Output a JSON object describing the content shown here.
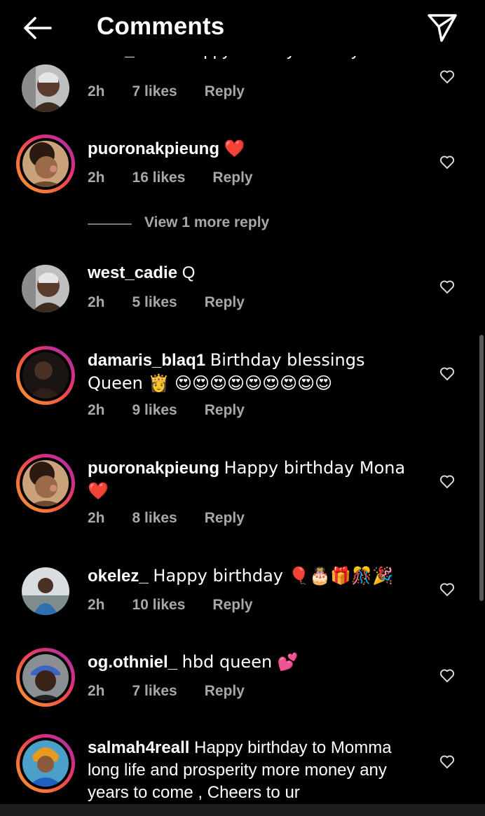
{
  "header": {
    "title": "Comments"
  },
  "comments": [
    {
      "username": "west_cadie",
      "text": "Happy birthday Mummy",
      "time": "2h",
      "likes": "7 likes",
      "reply": "Reply"
    },
    {
      "username": "puoronakpieung",
      "text": "❤️",
      "time": "2h",
      "likes": "16 likes",
      "reply": "Reply"
    },
    {
      "username": "west_cadie",
      "text": "Q",
      "time": "2h",
      "likes": "5 likes",
      "reply": "Reply"
    },
    {
      "username": "damaris_blaq1",
      "text": "Birthday blessings Queen 👸 😍😍😍😍😍😍😍😍😍",
      "time": "2h",
      "likes": "9 likes",
      "reply": "Reply"
    },
    {
      "username": "puoronakpieung",
      "text": "Happy birthday Mona ❤️",
      "time": "2h",
      "likes": "8 likes",
      "reply": "Reply"
    },
    {
      "username": "okelez_",
      "text": "Happy birthday 🎈🎂🎁🎊🎉",
      "time": "2h",
      "likes": "10 likes",
      "reply": "Reply"
    },
    {
      "username": "og.othniel_",
      "text": "hbd queen 💕",
      "time": "2h",
      "likes": "7 likes",
      "reply": "Reply"
    },
    {
      "username": "salmah4reall",
      "text": "Happy birthday to Momma long life and prosperity more money any years to come , Cheers to ur"
    }
  ],
  "view_replies": "View 1 more reply",
  "icons": {
    "back": "arrow-left-icon",
    "send": "paper-plane-icon",
    "like": "heart-outline-icon"
  },
  "colors": {
    "background": "#000000",
    "meta_text": "#a8a8a8",
    "story_ring_start": "#f9a12e",
    "story_ring_end": "#d92e7f"
  }
}
